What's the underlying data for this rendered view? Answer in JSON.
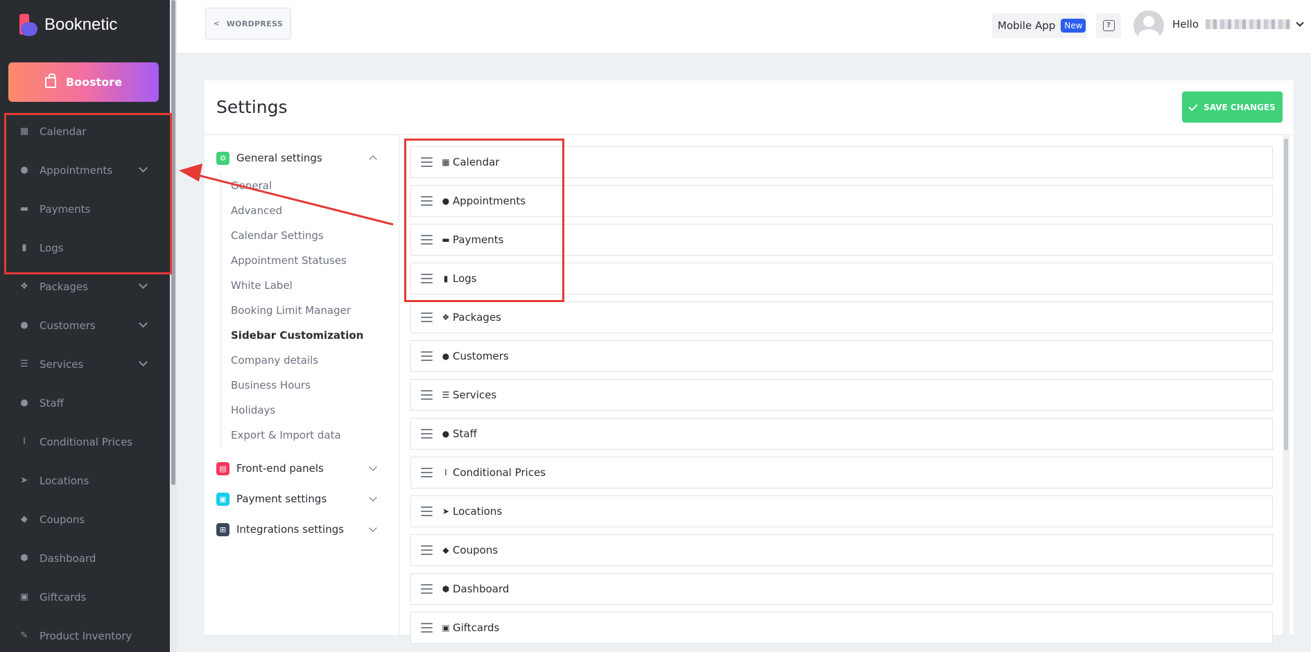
{
  "app": {
    "name": "Booknetic",
    "boostore_label": "Boostore"
  },
  "sidebar": {
    "items": [
      {
        "label": "Calendar",
        "icon": "calendar-icon",
        "glyph": "▦",
        "has_submenu": false
      },
      {
        "label": "Appointments",
        "icon": "clock-icon",
        "glyph": "●",
        "has_submenu": true
      },
      {
        "label": "Payments",
        "icon": "credit-card-icon",
        "glyph": "▬",
        "has_submenu": false
      },
      {
        "label": "Logs",
        "icon": "clipboard-icon",
        "glyph": "▮",
        "has_submenu": false
      },
      {
        "label": "Packages",
        "icon": "boxes-icon",
        "glyph": "❖",
        "has_submenu": true
      },
      {
        "label": "Customers",
        "icon": "users-icon",
        "glyph": "●",
        "has_submenu": true
      },
      {
        "label": "Services",
        "icon": "align-left-icon",
        "glyph": "☰",
        "has_submenu": true
      },
      {
        "label": "Staff",
        "icon": "user-icon",
        "glyph": "●",
        "has_submenu": false
      },
      {
        "label": "Conditional Prices",
        "icon": "text-cursor-icon",
        "glyph": "I",
        "has_submenu": false
      },
      {
        "label": "Locations",
        "icon": "location-arrow-icon",
        "glyph": "➤",
        "has_submenu": false
      },
      {
        "label": "Coupons",
        "icon": "tag-icon",
        "glyph": "◆",
        "has_submenu": false
      },
      {
        "label": "Dashboard",
        "icon": "cube-icon",
        "glyph": "⬢",
        "has_submenu": false
      },
      {
        "label": "Giftcards",
        "icon": "gift-icon",
        "glyph": "▣",
        "has_submenu": false
      },
      {
        "label": "Product Inventory",
        "icon": "tools-icon",
        "glyph": "✎",
        "has_submenu": false
      }
    ]
  },
  "topbar": {
    "back_label": "WORDPRESS",
    "mobile_app_label": "Mobile App",
    "mobile_app_badge": "New",
    "help_glyph": "?",
    "hello_label": "Hello"
  },
  "settings": {
    "title": "Settings",
    "save_label": "SAVE CHANGES",
    "groups": [
      {
        "label": "General settings",
        "icon": "settings-gear-icon",
        "color": "#3fd277",
        "glyph": "⚙",
        "expanded": true
      },
      {
        "label": "Front-end panels",
        "icon": "frontend-panel-icon",
        "color": "#f5365c",
        "glyph": "▤",
        "expanded": false
      },
      {
        "label": "Payment settings",
        "icon": "payment-settings-icon",
        "color": "#11cdef",
        "glyph": "▣",
        "expanded": false
      },
      {
        "label": "Integrations settings",
        "icon": "integrations-icon",
        "color": "#3a4a5c",
        "glyph": "⊞",
        "expanded": false
      }
    ],
    "general_submenu": [
      {
        "label": "General",
        "active": false
      },
      {
        "label": "Advanced",
        "active": false
      },
      {
        "label": "Calendar Settings",
        "active": false
      },
      {
        "label": "Appointment Statuses",
        "active": false
      },
      {
        "label": "White Label",
        "active": false
      },
      {
        "label": "Booking Limit Manager",
        "active": false
      },
      {
        "label": "Sidebar Customization",
        "active": true
      },
      {
        "label": "Company details",
        "active": false
      },
      {
        "label": "Business Hours",
        "active": false
      },
      {
        "label": "Holidays",
        "active": false
      },
      {
        "label": "Export & Import data",
        "active": false
      }
    ],
    "sortable_items": [
      {
        "label": "Calendar",
        "icon": "calendar-icon",
        "glyph": "▦"
      },
      {
        "label": "Appointments",
        "icon": "clock-icon",
        "glyph": "●"
      },
      {
        "label": "Payments",
        "icon": "credit-card-icon",
        "glyph": "▬"
      },
      {
        "label": "Logs",
        "icon": "clipboard-icon",
        "glyph": "▮"
      },
      {
        "label": "Packages",
        "icon": "boxes-icon",
        "glyph": "❖"
      },
      {
        "label": "Customers",
        "icon": "users-icon",
        "glyph": "●"
      },
      {
        "label": "Services",
        "icon": "align-left-icon",
        "glyph": "☰"
      },
      {
        "label": "Staff",
        "icon": "user-icon",
        "glyph": "●"
      },
      {
        "label": "Conditional Prices",
        "icon": "text-cursor-icon",
        "glyph": "I"
      },
      {
        "label": "Locations",
        "icon": "location-arrow-icon",
        "glyph": "➤"
      },
      {
        "label": "Coupons",
        "icon": "tag-icon",
        "glyph": "◆"
      },
      {
        "label": "Dashboard",
        "icon": "cube-icon",
        "glyph": "⬢"
      },
      {
        "label": "Giftcards",
        "icon": "gift-icon",
        "glyph": "▣"
      }
    ]
  },
  "colors": {
    "sidebar_bg": "#292d32",
    "save_green": "#3fd277",
    "badge_blue": "#2c5cf0",
    "annotation_red": "#e53935"
  }
}
